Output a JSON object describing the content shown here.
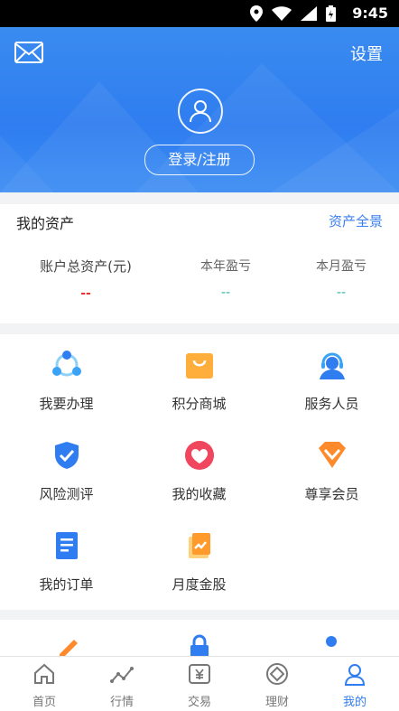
{
  "status": {
    "time": "9:45"
  },
  "header": {
    "settings_label": "设置",
    "login_label": "登录/注册"
  },
  "assets": {
    "title": "我的资产",
    "overview_label": "资产全景",
    "total_label": "账户总资产(元)",
    "total_value": "--",
    "year_label": "本年盈亏",
    "year_value": "--",
    "month_label": "本月盈亏",
    "month_value": "--"
  },
  "services": [
    {
      "label": "我要办理",
      "icon": "share-nodes-icon"
    },
    {
      "label": "积分商城",
      "icon": "shopping-bag-icon"
    },
    {
      "label": "服务人员",
      "icon": "headset-person-icon"
    },
    {
      "label": "风险测评",
      "icon": "shield-check-icon"
    },
    {
      "label": "我的收藏",
      "icon": "heart-icon"
    },
    {
      "label": "尊享会员",
      "icon": "vip-diamond-icon"
    },
    {
      "label": "我的订单",
      "icon": "order-list-icon"
    },
    {
      "label": "月度金股",
      "icon": "stock-report-icon"
    }
  ],
  "nav": [
    {
      "label": "首页",
      "icon": "home-icon"
    },
    {
      "label": "行情",
      "icon": "market-trend-icon"
    },
    {
      "label": "交易",
      "icon": "trade-yen-icon"
    },
    {
      "label": "理财",
      "icon": "wealth-icon"
    },
    {
      "label": "我的",
      "icon": "profile-icon"
    }
  ],
  "colors": {
    "primary": "#2f7df0",
    "accent_red": "#e23434",
    "accent_teal": "#2bb4a0"
  }
}
